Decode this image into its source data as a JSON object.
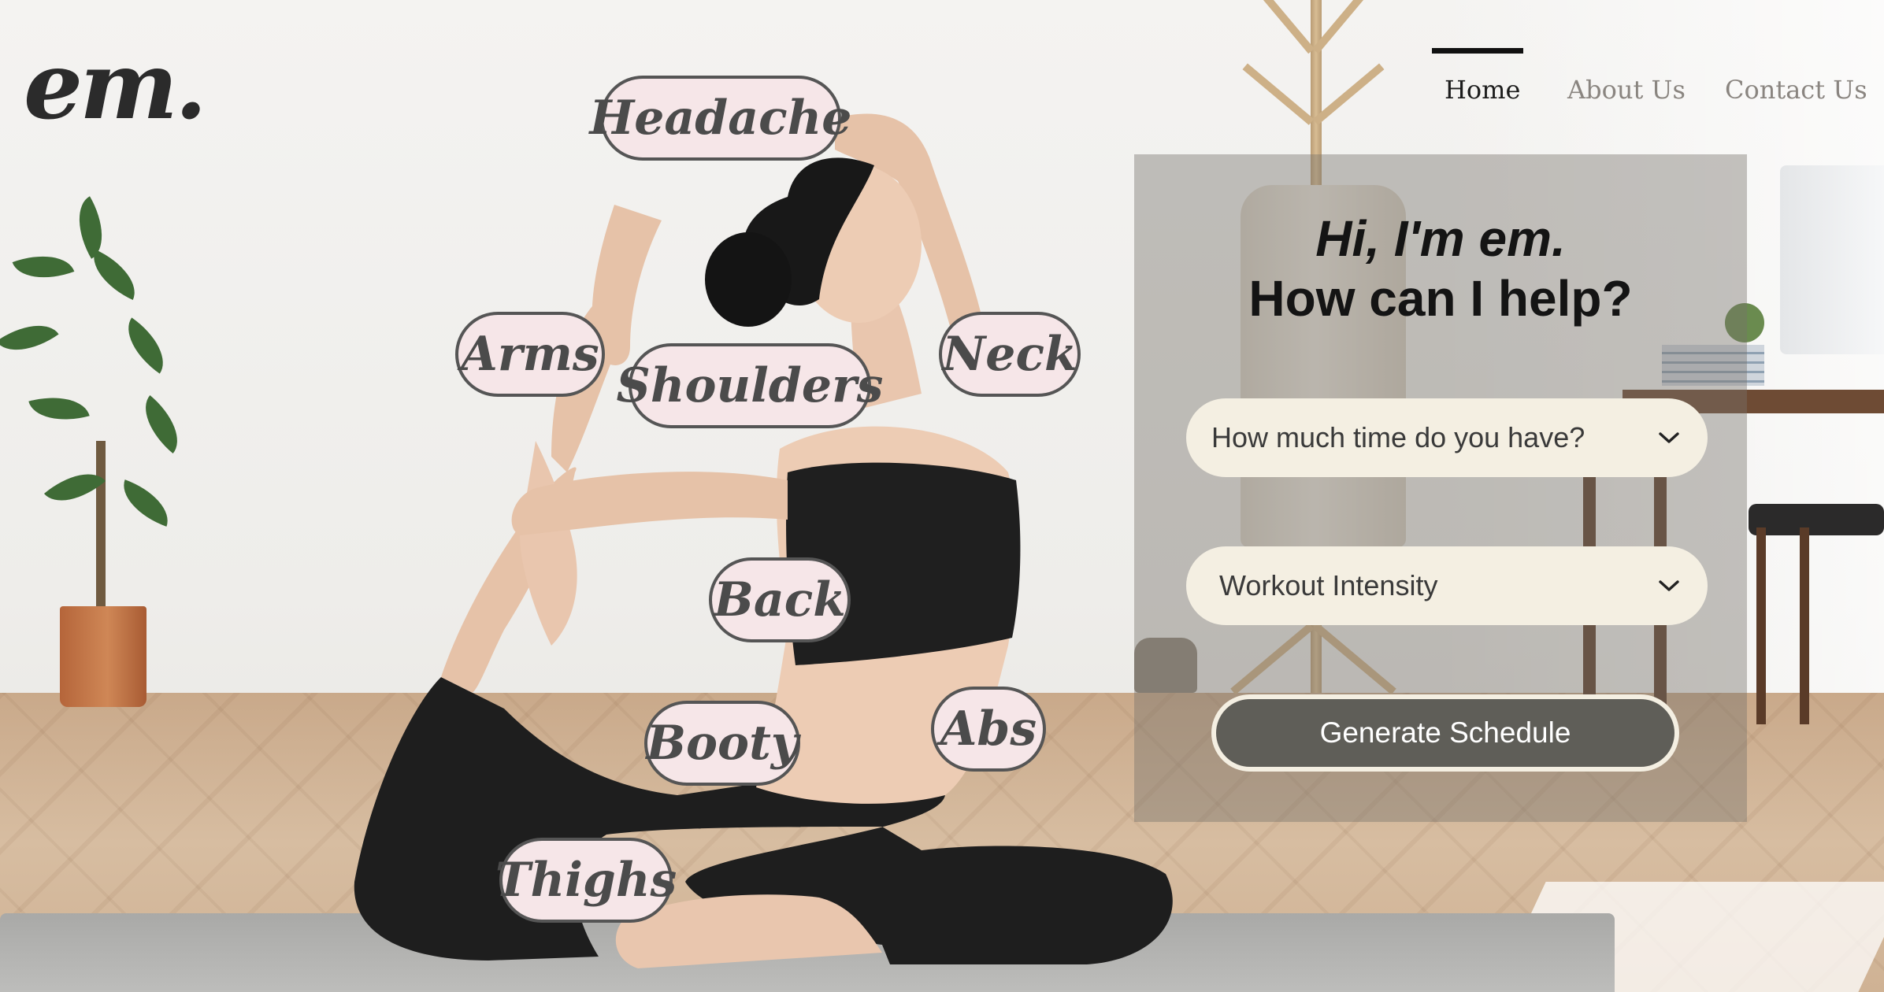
{
  "brand": {
    "logo_text": "em."
  },
  "nav": {
    "items": [
      {
        "label": "Home",
        "active": true
      },
      {
        "label": "About Us",
        "active": false
      },
      {
        "label": "Contact Us",
        "active": false
      }
    ]
  },
  "body_parts": [
    "Headache",
    "Arms",
    "Shoulders",
    "Neck",
    "Back",
    "Booty",
    "Abs",
    "Thighs"
  ],
  "panel": {
    "greeting_line1": "Hi, I'm em.",
    "greeting_line2": "How can I help?",
    "time_select": {
      "selected": "How much time do you have?",
      "icon": "chevron-down-icon"
    },
    "intensity_select": {
      "selected": "Workout Intensity",
      "icon": "chevron-down-icon"
    },
    "generate_button": "Generate Schedule"
  },
  "colors": {
    "bubble_fill": "#f6e6e8",
    "bubble_border": "#555555",
    "select_fill": "#f4efe2",
    "button_fill": "#5f5e58",
    "panel_overlay": "rgba(120,115,108,0.42)"
  }
}
